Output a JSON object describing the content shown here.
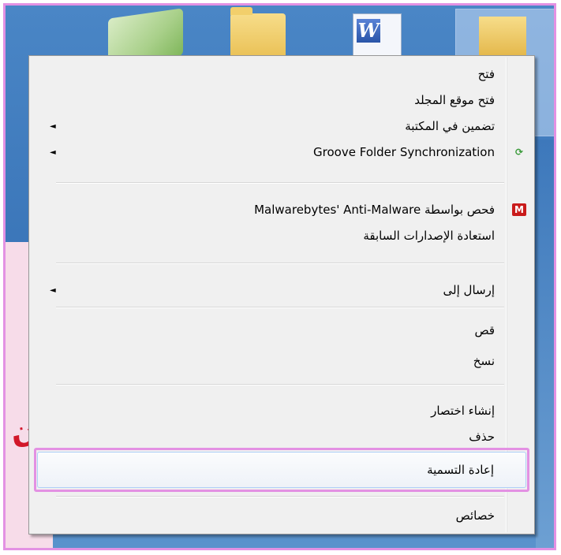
{
  "menu": {
    "items": [
      {
        "label": "فتح",
        "has_submenu": false,
        "icon": null
      },
      {
        "label": "فتح موقع المجلد",
        "has_submenu": false,
        "icon": null
      },
      {
        "label": "تضمين في المكتبة",
        "has_submenu": true,
        "icon": null
      },
      {
        "label": "Groove Folder Synchronization",
        "has_submenu": true,
        "icon": "groove-icon"
      },
      {
        "label": "فحص بواسطة Malwarebytes' Anti-Malware",
        "has_submenu": false,
        "icon": "malwarebytes-icon"
      },
      {
        "label": "استعادة الإصدارات السابقة",
        "has_submenu": false,
        "icon": null
      },
      {
        "label": "إرسال إلى",
        "has_submenu": true,
        "icon": null
      },
      {
        "label": "قص",
        "has_submenu": false,
        "icon": null
      },
      {
        "label": "نسخ",
        "has_submenu": false,
        "icon": null
      },
      {
        "label": "إنشاء اختصار",
        "has_submenu": false,
        "icon": null
      },
      {
        "label": "حذف",
        "has_submenu": false,
        "icon": null
      },
      {
        "label": "إعادة التسمية",
        "has_submenu": false,
        "icon": null,
        "highlighted": true
      },
      {
        "label": "خصائص",
        "has_submenu": false,
        "icon": null
      }
    ],
    "submenu_arrow": "◄",
    "groove_icon_glyph": "⟳",
    "malwarebytes_icon_glyph": "M"
  },
  "desktop": {
    "word_icon_letter": "W",
    "red_scrawl_text": "ن"
  },
  "colors": {
    "highlight_frame": "#e391e3",
    "menu_bg": "#f0f0f0",
    "desktop_bg": "#3b76b9"
  }
}
